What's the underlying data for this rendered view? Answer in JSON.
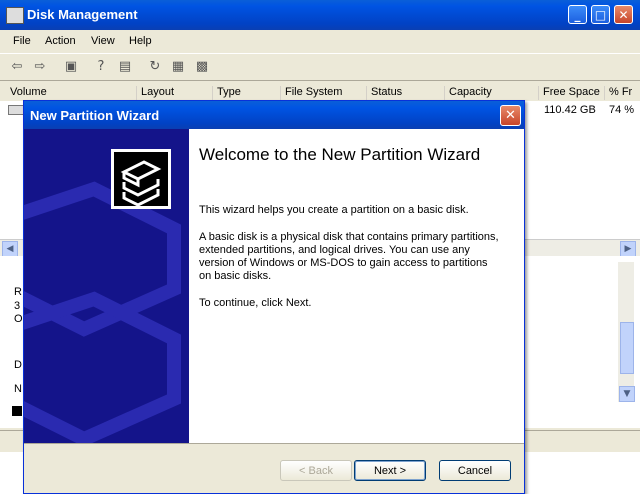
{
  "app": {
    "title": "Disk Management"
  },
  "menu": [
    "File",
    "Action",
    "View",
    "Help"
  ],
  "toolbar_icons": [
    "back-icon",
    "forward-icon",
    "show-hide-console-tree-icon",
    "help-icon",
    "properties-icon",
    "refresh-icon",
    "rescan-disks-icon",
    "disk-settings-icon"
  ],
  "list": {
    "columns": [
      "Volume",
      "Layout",
      "Type",
      "File System",
      "Status",
      "Capacity",
      "Free Space",
      "% Fr"
    ],
    "rows": [
      {
        "free_space": "110.42 GB",
        "percent_free": "74 %"
      }
    ]
  },
  "lower_pane_fragments": [
    "R",
    "3",
    "O",
    "D",
    "N"
  ],
  "wizard": {
    "title": "New Partition Wizard",
    "heading": "Welcome to the New Partition Wizard",
    "para1": "This wizard helps you create a partition on a basic disk.",
    "para2": "A basic disk is a physical disk that contains primary partitions, extended partitions, and logical drives. You can use any version of Windows or MS-DOS to gain access to partitions on basic disks.",
    "para3": "To continue, click Next.",
    "buttons": {
      "back": "< Back",
      "next": "Next >",
      "cancel": "Cancel"
    }
  },
  "colors": {
    "titlebar": "#0054e3",
    "wizard_side": "#14148a",
    "window_bg": "#ece9d8"
  }
}
